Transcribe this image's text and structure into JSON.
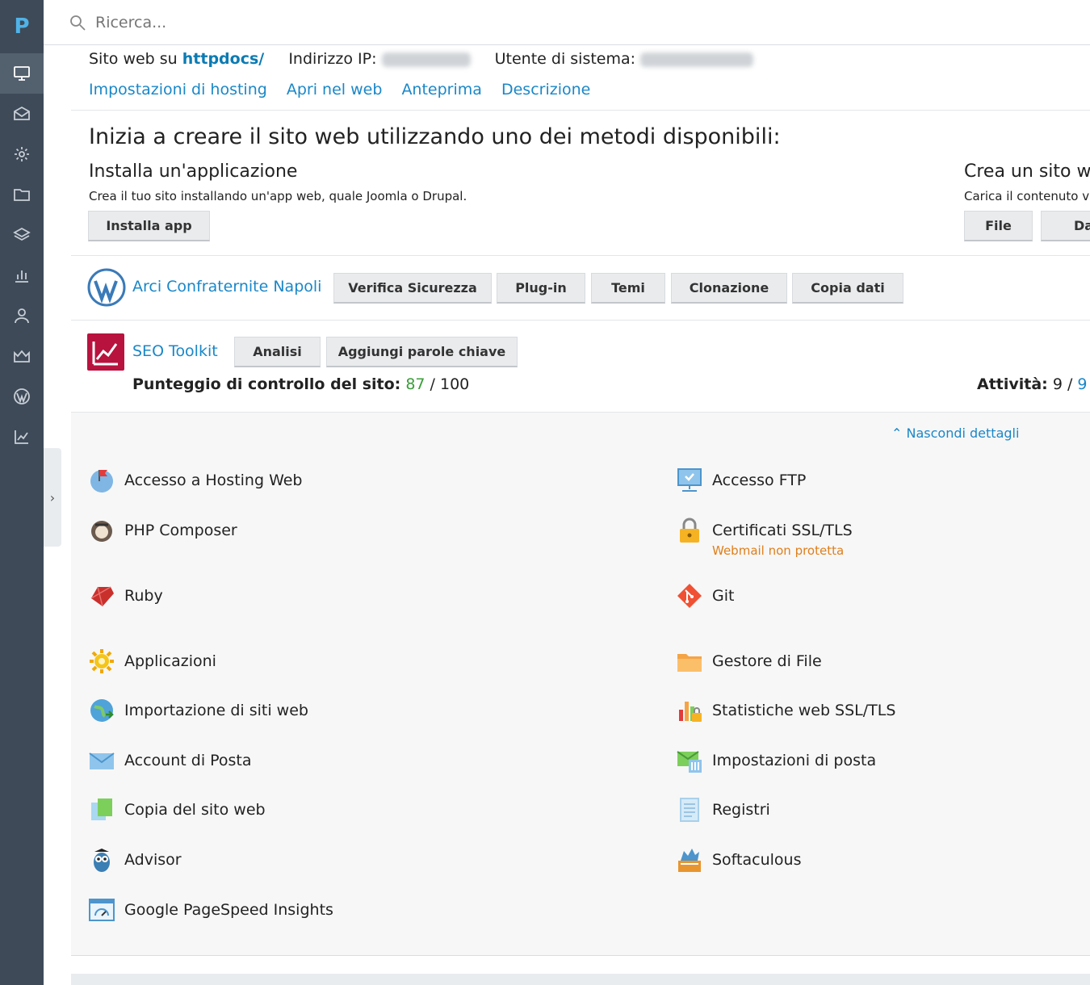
{
  "rail": {
    "logo": "P",
    "items": [
      {
        "icon": "monitor-icon",
        "active": true
      },
      {
        "icon": "mail-icon",
        "active": false
      },
      {
        "icon": "gear-icon",
        "active": false
      },
      {
        "icon": "folder-icon",
        "active": false
      },
      {
        "icon": "layers-icon",
        "active": false
      },
      {
        "icon": "bar-chart-icon",
        "active": false
      },
      {
        "icon": "user-icon",
        "active": false
      },
      {
        "icon": "crown-icon",
        "active": false
      },
      {
        "icon": "wordpress-icon",
        "active": false
      },
      {
        "icon": "seo-chart-icon",
        "active": false
      }
    ]
  },
  "search": {
    "placeholder": "Ricerca..."
  },
  "info": {
    "site_prefix": "Sito web su ",
    "site_link": "httpdocs/",
    "ip_label": "Indirizzo IP:",
    "user_label": "Utente di sistema:"
  },
  "links": [
    "Impostazioni di hosting",
    "Apri nel web",
    "Anteprima",
    "Descrizione"
  ],
  "create": {
    "heading": "Inizia a creare il sito web utilizzando uno dei metodi disponibili:",
    "install_title": "Installa un'applicazione",
    "install_desc": "Crea il tuo sito installando un'app web, quale Joomla o Drupal.",
    "install_button": "Installa app",
    "right_title": "Crea un sito we",
    "right_desc": "Carica il contenuto v",
    "file_button": "File",
    "data_button": "Data"
  },
  "wordpress": {
    "name": "Arci Confraternite Napoli",
    "buttons": [
      "Verifica Sicurezza",
      "Plug-in",
      "Temi",
      "Clonazione",
      "Copia dati"
    ]
  },
  "seo": {
    "name": "SEO Toolkit",
    "buttons": [
      "Analisi",
      "Aggiungi parole chiave"
    ],
    "score_label": "Punteggio di controllo del sito:",
    "score_value": "87",
    "score_sep": " / ",
    "score_max": "100",
    "activity_label": "Attività:",
    "activity_value": " 9 / ",
    "activity_total": "9"
  },
  "details": {
    "hide_link": "Nascondi dettagli",
    "left_tools": [
      {
        "label": "Accesso a Hosting Web",
        "icon": "globe-flag-icon"
      },
      {
        "label": "PHP Composer",
        "icon": "composer-icon"
      },
      {
        "label": "Ruby",
        "icon": "ruby-icon"
      },
      {
        "label": "Applicazioni",
        "icon": "sun-gear-icon"
      },
      {
        "label": "Importazione di siti web",
        "icon": "globe-import-icon"
      },
      {
        "label": "Account di Posta",
        "icon": "envelope-icon"
      },
      {
        "label": "Copia del sito web",
        "icon": "copy-icon"
      },
      {
        "label": "Advisor",
        "icon": "owl-icon"
      },
      {
        "label": "Google PageSpeed Insights",
        "icon": "speedometer-icon"
      }
    ],
    "right_tools": [
      {
        "label": "Accesso FTP",
        "icon": "ftp-icon"
      },
      {
        "label": "Certificati SSL/TLS",
        "icon": "padlock-icon",
        "warning": "Webmail non protetta"
      },
      {
        "label": "Git",
        "icon": "git-icon"
      },
      {
        "label": "Gestore di File",
        "icon": "folder-icon"
      },
      {
        "label": "Statistiche web SSL/TLS",
        "icon": "stats-lock-icon"
      },
      {
        "label": "Impostazioni di posta",
        "icon": "mail-settings-icon"
      },
      {
        "label": "Registri",
        "icon": "log-icon"
      },
      {
        "label": "Softaculous",
        "icon": "softaculous-icon"
      }
    ]
  },
  "colors": {
    "rail": "#3e4a58",
    "link": "#1a87c8",
    "score_green": "#3a9d3a",
    "warning": "#e07e1a",
    "seo_brand": "#b8123e"
  }
}
